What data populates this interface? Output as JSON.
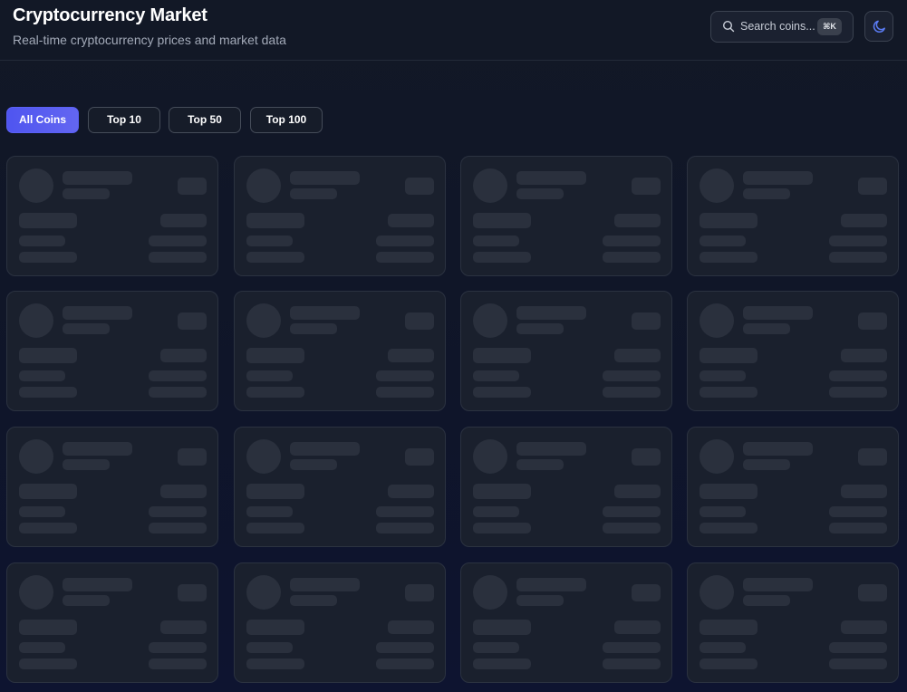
{
  "header": {
    "title": "Cryptocurrency Market",
    "subtitle": "Real-time cryptocurrency prices and market data"
  },
  "search": {
    "placeholder": "Search coins...",
    "shortcut": "⌘K",
    "icon": "search-icon"
  },
  "theme_toggle": {
    "icon": "moon-icon",
    "accent": "#5b7cf5"
  },
  "filters": [
    {
      "label": "All Coins",
      "active": true
    },
    {
      "label": "Top 10",
      "active": false
    },
    {
      "label": "Top 50",
      "active": false
    },
    {
      "label": "Top 100",
      "active": false
    }
  ],
  "colors": {
    "background": "#0f1529",
    "accent": "#5a60f5",
    "card": "#1a202d",
    "skeleton": "#2a303d"
  },
  "grid": {
    "rows": 4,
    "columns": 4,
    "state": "loading"
  }
}
